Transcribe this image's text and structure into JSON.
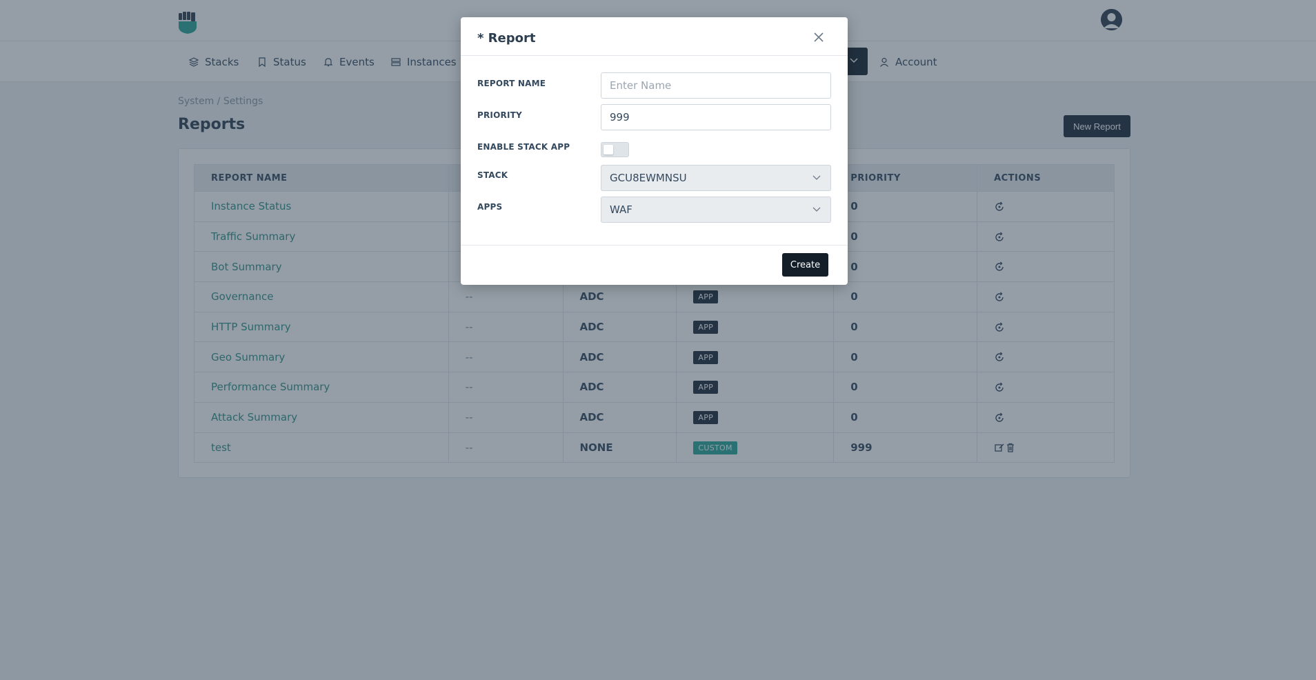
{
  "nav": {
    "items": [
      {
        "label": "Stacks",
        "icon": "layers-icon"
      },
      {
        "label": "Status",
        "icon": "bookmark-icon"
      },
      {
        "label": "Events",
        "icon": "bell-icon"
      },
      {
        "label": "Instances",
        "icon": "server-icon"
      },
      {
        "label": "Account",
        "icon": "user-icon"
      }
    ]
  },
  "breadcrumb": "System / Settings",
  "page": {
    "title": "Reports",
    "new_report_label": "New Report"
  },
  "table": {
    "headers": [
      "REPORT NAME",
      "",
      "",
      "",
      "PRIORITY",
      "ACTIONS"
    ],
    "rows": [
      {
        "name": "Instance Status",
        "col2": "",
        "type": "",
        "badge": "",
        "priority": "0"
      },
      {
        "name": "Traffic Summary",
        "col2": "",
        "type": "",
        "badge": "",
        "priority": "0"
      },
      {
        "name": "Bot Summary",
        "col2": "",
        "type": "",
        "badge": "",
        "priority": "0"
      },
      {
        "name": "Governance",
        "col2": "--",
        "type": "ADC",
        "badge": "APP",
        "priority": "0"
      },
      {
        "name": "HTTP Summary",
        "col2": "--",
        "type": "ADC",
        "badge": "APP",
        "priority": "0"
      },
      {
        "name": "Geo Summary",
        "col2": "--",
        "type": "ADC",
        "badge": "APP",
        "priority": "0"
      },
      {
        "name": "Performance Summary",
        "col2": "--",
        "type": "ADC",
        "badge": "APP",
        "priority": "0"
      },
      {
        "name": "Attack Summary",
        "col2": "--",
        "type": "ADC",
        "badge": "APP",
        "priority": "0"
      },
      {
        "name": "test",
        "col2": "--",
        "type": "NONE",
        "badge": "CUSTOM",
        "priority": "999"
      }
    ]
  },
  "modal": {
    "title": "* Report",
    "fields": {
      "report_name_label": "REPORT NAME",
      "report_name_placeholder": "Enter Name",
      "report_name_value": "",
      "priority_label": "PRIORITY",
      "priority_value": "999",
      "enable_stack_app_label": "ENABLE STACK APP",
      "enable_stack_app_on": false,
      "stack_label": "STACK",
      "stack_value": "GCU8EWMNSU",
      "apps_label": "APPS",
      "apps_value": "WAF"
    },
    "create_label": "Create"
  },
  "colors": {
    "link": "#2e8f86",
    "dark": "#1c2a38",
    "custom_badge": "#26a596"
  }
}
